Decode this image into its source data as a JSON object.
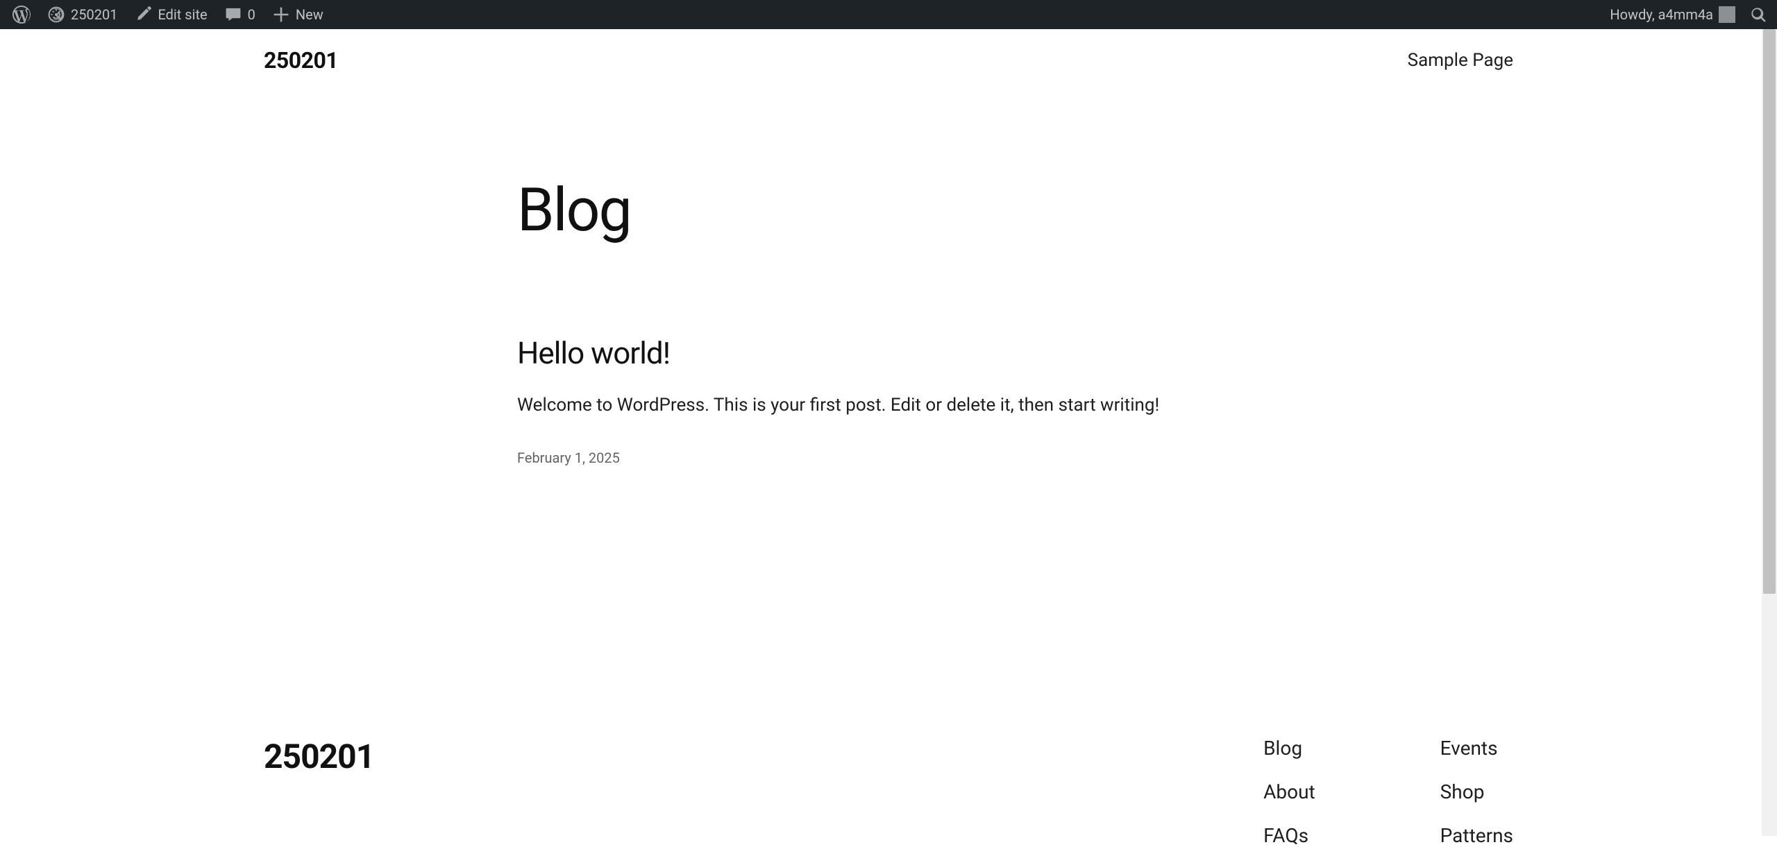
{
  "admin_bar": {
    "site_name": "250201",
    "edit_site": "Edit site",
    "comments_count": "0",
    "new_label": "New",
    "howdy_prefix": "Howdy, ",
    "username": "a4mm4a"
  },
  "header": {
    "site_title": "250201",
    "nav": [
      {
        "label": "Sample Page"
      }
    ]
  },
  "main": {
    "page_heading": "Blog",
    "posts": [
      {
        "title": "Hello world!",
        "excerpt": "Welcome to WordPress. This is your first post. Edit or delete it, then start writing!",
        "date": "February 1, 2025"
      }
    ]
  },
  "footer": {
    "site_title": "250201",
    "columns": [
      [
        "Blog",
        "About",
        "FAQs"
      ],
      [
        "Events",
        "Shop",
        "Patterns"
      ]
    ]
  }
}
